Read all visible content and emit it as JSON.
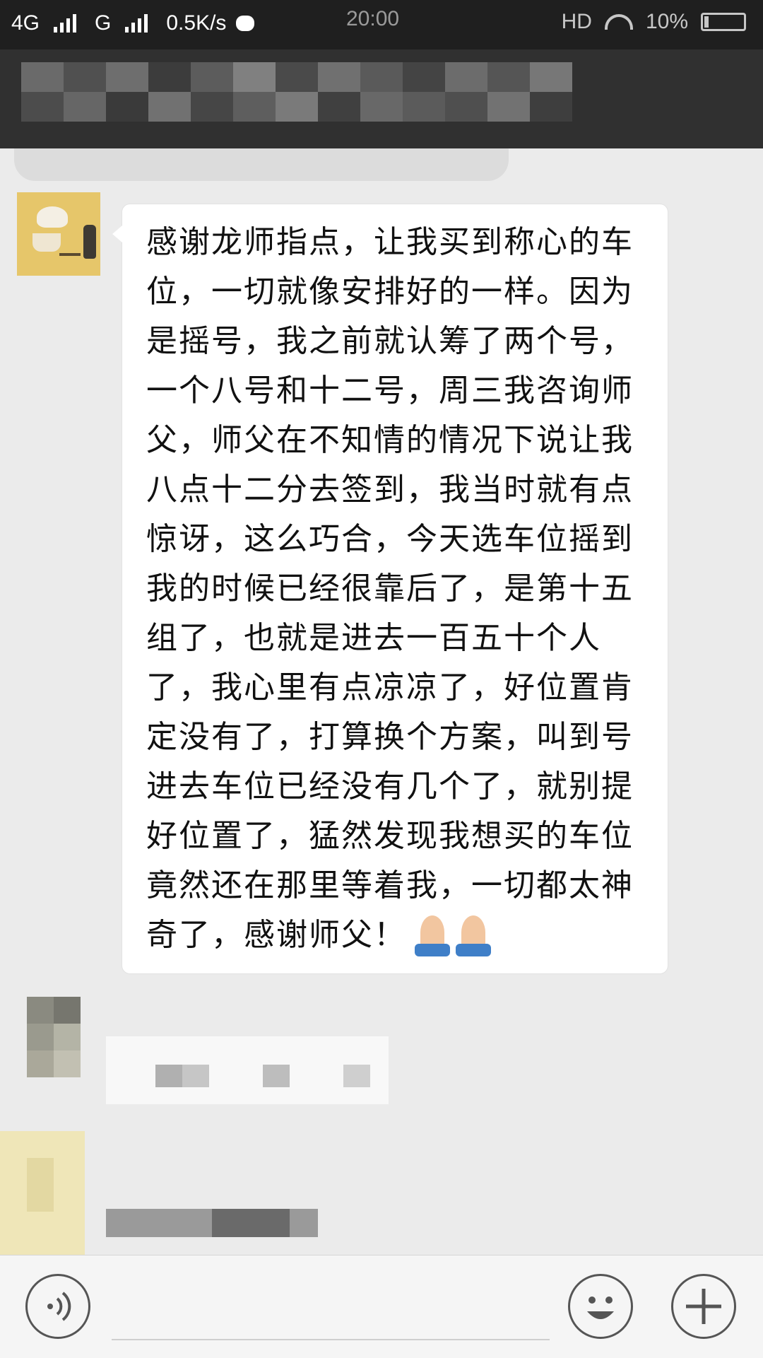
{
  "status_bar": {
    "network_left": "4G",
    "network_right": "G",
    "speed": "0.5K/s",
    "time": "20:00",
    "hd": "HD",
    "battery": "10%"
  },
  "message": {
    "lines": [
      "感谢龙师指点，让我买到称心的车",
      "位，一切就像安排好的一样。因为",
      "是摇号，我之前就认筹了两个号，",
      "一个八号和十二号，周三我咨询师",
      "父，师父在不知情的情况下说让我",
      "八点十二分去签到，我当时就有点",
      "惊讶，这么巧合，今天选车位摇到",
      "我的时候已经很靠后了，是第十五",
      "组了，也就是进去一百五十个人",
      "了，我心里有点凉凉了，好位置肯",
      "定没有了，打算换个方案，叫到号",
      "进去车位已经没有几个了，就别提",
      "好位置了，猛然发现我想买的车位",
      "竟然还在那里等着我，一切都太神",
      "奇了，感谢师父！"
    ],
    "emoji": "folded-hands-x2"
  },
  "icons": {
    "voice": "voice-icon",
    "emoji": "smiley-icon",
    "plus": "plus-icon"
  }
}
